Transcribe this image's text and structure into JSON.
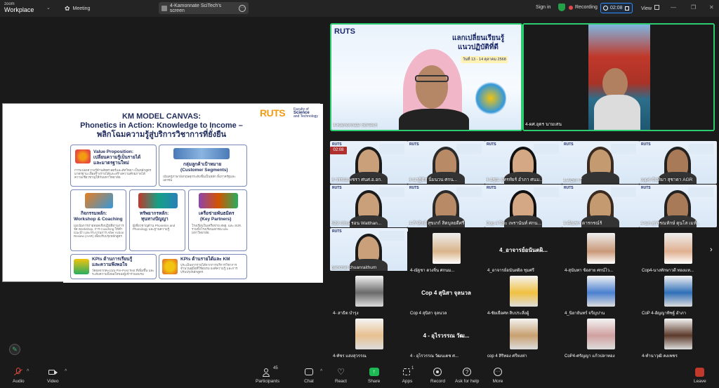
{
  "app": {
    "brand_top": "zoom",
    "brand_bottom": "Workplace"
  },
  "topbar": {
    "meeting_label": "Meeting",
    "share_tab_title": "4-Kamonnate SciTech's screen",
    "sign_in": "Sign in",
    "recording_label": "Recording",
    "timer": "02:08",
    "view_label": "View"
  },
  "slide": {
    "title_line1": "KM MODEL CANVAS:",
    "title_line2": "Phonetics in Action: Knowledge to Income –",
    "title_line3": "พลิกโฉมความรู้สู่บริการวิชาการที่ยั่งยืน",
    "logo_text": "RUTS",
    "logo_sub1": "Faculty of",
    "logo_sub2": "Science",
    "logo_sub3": "and Technology",
    "cards": [
      {
        "title": "Value Proposition:",
        "sub1": "เปลี่ยนความรู้เป็นรายได้",
        "sub2": "และมาตรฐานใหม่",
        "desc": "การแปลงความรู้ด้านสัทศาสตร์และสัทวิทยา เป็นหลักสูตรมาตรฐาน เพื่อสร้างรายได้และสร้างความศักยภาพได้ ความเชี่ยวชาญให้กับมหาวิทยาลัย"
      },
      {
        "title": "กลุ่มลูกค้าเป้าหมาย",
        "sub1": "(Customer Segments)",
        "desc": "เน้นครูภาษาอังกฤษทุกระดับชั้นเป็นหลัก ทั้งภาครัฐและเอกชน"
      },
      {
        "title": "กิจกรรมหลัก:",
        "sub1": "Workshop & Coaching",
        "desc": "มุ่งเน้นการถ่ายทอดเชิงปฏิบัติผ่านการจัด Workshop, การ Coaching ให้คำแนะนำ และกระบวนการ After Action Review (AAR) เพื่อปรับปรุงหลักสูตร"
      },
      {
        "title": "ทรัพยากรหลัก:",
        "sub1": "ทุนทางปัญญา",
        "desc": "ผู้เชี่ยวชาญด้าน Phonetics and Phonology และฐานความรู้"
      },
      {
        "title": "เครือข่ายพันธมิตร",
        "sub1": "(Key Partners)",
        "desc": "โรงเรียนในเครือข่าย สพฐ. และ อปท. รวมทั้งโรงเรียนเอกชน และ มหาวิทยาลัย"
      },
      {
        "title": "KPIs ด้านการเรียนรู้",
        "sub1": "และความพึงพอใจ",
        "desc": "วัดผลจากคะแนน Pre-Post Test ที่เพิ่มขึ้น และระดับความพึงพอใจของผู้เข้าร่วมอบรม"
      },
      {
        "title": "KPIs ด้านรายได้และ KM",
        "desc": "ประเมินจากรายได้จากการบริการวิชาการ จำนวนคู่มือที่ใช้อบรม องค์ความรู้ และการปรับปรุงหลักสูตร"
      }
    ]
  },
  "video_top": [
    {
      "name": "4-Kamonnate SciTech",
      "banner_title": "แลกเปลี่ยนเรียนรู้",
      "banner_sub": "แนวปฏิบัติที่ดี",
      "banner_date": "วันที่ 13 - 14 ตุลาคม 2568"
    },
    {
      "name": "4-ผศ.อุดร นามเสน"
    }
  ],
  "grid_timer": "02:08",
  "grid_rows": [
    [
      "4-วรรณเพชรา ศนศ.อ.อก.",
      "4-นาฏิติส นิ่มนวน ศกน...",
      "4-อรุณ จุทรทัยร์ อำภา ศนม...",
      "4-AGR IT",
      "cop4-จันทิมา สุชาดา AGR"
    ],
    [
      "522 Ultra รอน Watthan...",
      "4-ก้าศิลย์ สุขเกก์ สิตบุลยดีศรี",
      "Cop 4 ปิยะ เพรานันท์ ศกน...",
      "4-คัณฑา ดารกรณ์ร้",
      "4-นภ.สุวรรณทักษ์ ดุนโส เมห์..."
    ],
    [
      "parichat chuanraithum",
      "4-ณัฐชา ดวงจิ่น ศกนม...",
      "4_อาจารย์อนันตผิล ชุมศรี",
      "4-สุนันทา ช้อสาย ศกน์ไว...",
      "Cop4-นางทักษาวดี ทองแท..."
    ]
  ],
  "caption_tiles": [
    {
      "center_text": "4_อาจารย์อนันตผิ...",
      "name": "4_อาจารย์อนันตผิล ชุมศรี"
    },
    {
      "name": "4- สาธิต บำรุง"
    },
    {
      "center_text": "Cop 4 สุนิสา จุลนวล",
      "name": "Cop 4 สุนิสา จุลนวล"
    },
    {
      "name": "4-ชัยเยือศท สิบประสิ่งผู้"
    },
    {
      "name": "4_นิยายันทร์ จรีญปาน"
    },
    {
      "name": "CoP 4-อัญญาทิชฐ์ อำภา"
    },
    {
      "name": "4-ทัชร แสงสุวรรณ"
    },
    {
      "center_text": "4 - อุไรวรรณ วัฒ...",
      "name": "4 - อุไรวรรณ วัฒนเดช ศ..."
    },
    {
      "name": "cop 4 สิริทอง ศรีหงห่า"
    },
    {
      "name": "CoP4-ศรัญญา แก้วปลาทอง"
    },
    {
      "name": "4-ทำนาวุฒิ คงเพชร"
    }
  ],
  "bottom_bar": {
    "audio": "Audio",
    "video": "Video",
    "participants": "Participants",
    "participants_count": "45",
    "chat": "Chat",
    "react": "React",
    "share": "Share",
    "apps": "Apps",
    "apps_badge": "1",
    "record": "Record",
    "ask_help": "Ask for help",
    "more": "More",
    "leave": "Leave"
  },
  "colors": {
    "accent": "#2d8cff",
    "active_speaker": "#2ecc71",
    "share_green": "#1db954",
    "leave_red": "#c0392b",
    "recording_red": "#e5484d"
  }
}
